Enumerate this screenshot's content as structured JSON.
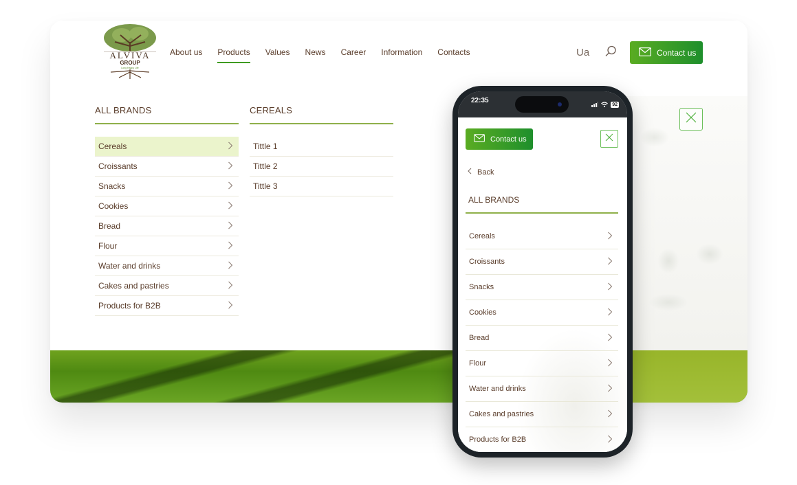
{
  "colors": {
    "accent_green": "#3f9b22",
    "text_brown": "#5a3d2b",
    "active_row_bg": "#ebf4cc",
    "divider_green": "#8fb04a"
  },
  "logo": {
    "name": "ALVIVA",
    "sub": "GROUP",
    "tagline": "Long Happy Life"
  },
  "nav": {
    "items": [
      {
        "label": "About us",
        "active": false
      },
      {
        "label": "Products",
        "active": true
      },
      {
        "label": "Values",
        "active": false
      },
      {
        "label": "News",
        "active": false
      },
      {
        "label": "Career",
        "active": false
      },
      {
        "label": "Information",
        "active": false
      },
      {
        "label": "Contacts",
        "active": false
      }
    ],
    "language": "Ua",
    "search_icon": "search-icon",
    "contact_label": "Contact us"
  },
  "menu": {
    "brands_title": "ALL BRANDS",
    "brands": [
      {
        "label": "Cereals",
        "active": true
      },
      {
        "label": "Croissants",
        "active": false
      },
      {
        "label": "Snacks",
        "active": false
      },
      {
        "label": "Cookies",
        "active": false
      },
      {
        "label": "Bread",
        "active": false
      },
      {
        "label": "Flour",
        "active": false
      },
      {
        "label": "Water and drinks",
        "active": false
      },
      {
        "label": "Cakes and pastries",
        "active": false
      },
      {
        "label": "Products for B2B",
        "active": false
      }
    ],
    "sub_title": "CEREALS",
    "sub_items": [
      "Tittle 1",
      "Tittle 2",
      "Tittle 3"
    ]
  },
  "mobile": {
    "status": {
      "time": "22:35",
      "battery": "92"
    },
    "contact_label": "Contact us",
    "back_label": "Back",
    "title": "ALL BRANDS",
    "items": [
      "Cereals",
      "Croissants",
      "Snacks",
      "Cookies",
      "Bread",
      "Flour",
      "Water and drinks",
      "Cakes and pastries",
      "Products for B2B"
    ]
  }
}
